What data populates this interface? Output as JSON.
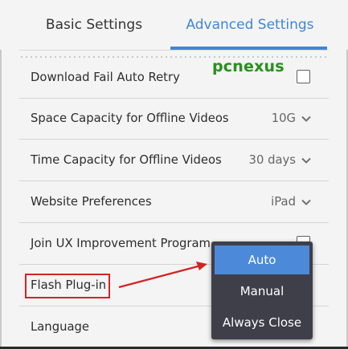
{
  "tabs": {
    "basic": "Basic Settings",
    "advanced": "Advanced Settings",
    "active": "advanced"
  },
  "watermark": "pcnexus",
  "settings": [
    {
      "label": "Download Fail Auto Retry",
      "control": "checkbox",
      "checked": false
    },
    {
      "label": "Space Capacity for Offline Videos",
      "control": "select",
      "value": "10G"
    },
    {
      "label": "Time Capacity for Offline Videos",
      "control": "select",
      "value": "30 days"
    },
    {
      "label": "Website Preferences",
      "control": "select",
      "value": "iPad"
    },
    {
      "label": "Join UX Improvement Program",
      "control": "checkbox",
      "checked": false
    },
    {
      "label": "Flash Plug-in",
      "control": "select",
      "value": "Auto"
    },
    {
      "label": "Language",
      "control": "select",
      "value": ""
    }
  ],
  "flash_dropdown": {
    "options": [
      "Auto",
      "Manual",
      "Always Close"
    ],
    "selected": "Auto"
  },
  "colors": {
    "accent": "#3f86d8",
    "annotation": "#d32424",
    "dropdown_bg": "#3f3f4a",
    "dropdown_selected": "#4c8ad9",
    "watermark": "#2e8d26"
  }
}
